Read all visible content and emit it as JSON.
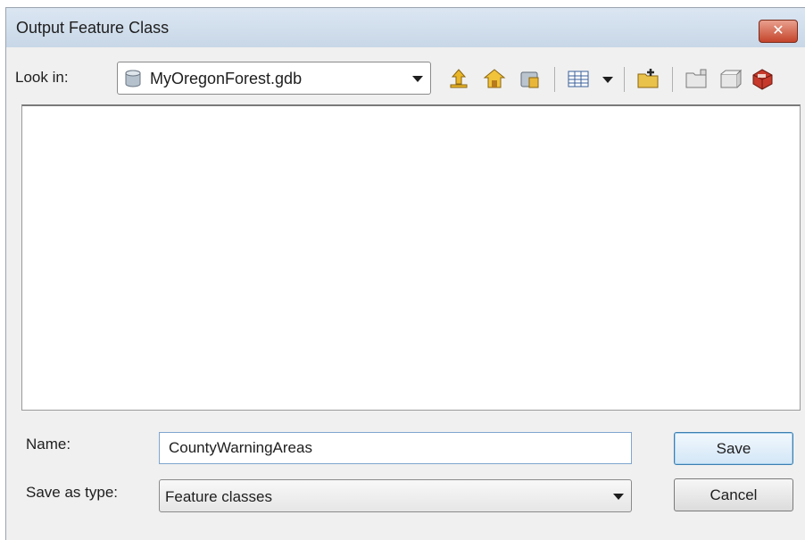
{
  "window": {
    "title": "Output Feature Class",
    "close_label": "✕"
  },
  "toolbar": {
    "look_in_label": "Look in:",
    "look_in_value": "MyOregonForest.gdb",
    "icons": [
      "up-one-level-icon",
      "home-icon",
      "connect-folder-icon",
      "view-menu-icon",
      "new-feature-dataset-icon",
      "new-folder-icon",
      "new-item-icon",
      "delete-icon"
    ]
  },
  "file_list": {
    "items": []
  },
  "form": {
    "name_label": "Name:",
    "name_value": "CountyWarningAreas",
    "type_label": "Save as type:",
    "type_value": "Feature classes"
  },
  "buttons": {
    "save_label": "Save",
    "cancel_label": "Cancel"
  },
  "colors": {
    "title_bar": "#c8d7e7",
    "close_button": "#c5452c",
    "default_button_border": "#3c7fb1"
  }
}
